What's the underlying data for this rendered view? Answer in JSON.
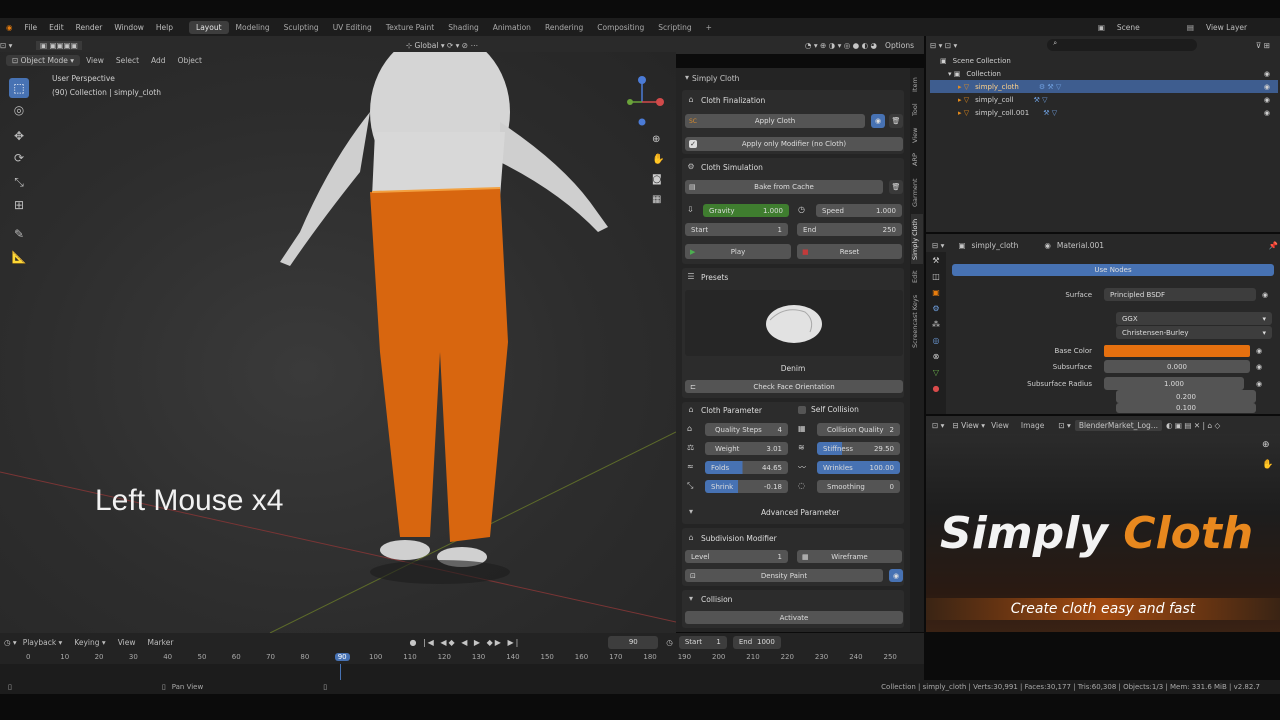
{
  "menu": [
    "File",
    "Edit",
    "Render",
    "Window",
    "Help"
  ],
  "workspaces": [
    "Layout",
    "Modeling",
    "Sculpting",
    "UV Editing",
    "Texture Paint",
    "Shading",
    "Animation",
    "Rendering",
    "Compositing",
    "Scripting"
  ],
  "scene": "Scene",
  "view_layer": "View Layer",
  "viewport": {
    "orientation": "Global",
    "options": "Options",
    "mode": "Object Mode",
    "menus": [
      "View",
      "Select",
      "Add",
      "Object"
    ],
    "overlay_title": "User Perspective",
    "overlay_sub": "(90) Collection | simply_cloth",
    "caption": "Left Mouse x4"
  },
  "n_tabs": [
    "Item",
    "Tool",
    "View",
    "ARP",
    "Garment",
    "Simply Cloth",
    "Edit",
    "Screencast Keys"
  ],
  "simply_cloth": {
    "title": "Simply Cloth",
    "finalization": {
      "title": "Cloth Finalization",
      "sc": "SC",
      "apply": "Apply Cloth",
      "apply_mod": "Apply only Modifier (no Cloth)"
    },
    "simulation": {
      "title": "Cloth Simulation",
      "bake": "Bake from Cache",
      "gravity_label": "Gravity",
      "gravity": "1.000",
      "speed_label": "Speed",
      "speed": "1.000",
      "start_label": "Start",
      "start": "1",
      "end_label": "End",
      "end": "250",
      "play": "Play",
      "reset": "Reset"
    },
    "presets": {
      "title": "Presets",
      "name": "Denim",
      "check": "Check Face Orientation"
    },
    "params": {
      "title": "Cloth Parameter",
      "self_collision": "Self Collision",
      "quality_label": "Quality Steps",
      "quality": "4",
      "collision_label": "Collision Quality",
      "collision": "2",
      "weight_label": "Weight",
      "weight": "3.01",
      "stiffness_label": "Stiffness",
      "stiffness": "29.50",
      "folds_label": "Folds",
      "folds": "44.65",
      "wrinkles_label": "Wrinkles",
      "wrinkles": "100.00",
      "shrink_label": "Shrink",
      "shrink": "-0.18",
      "smoothing_label": "Smoothing",
      "smoothing": "0",
      "advanced": "Advanced Parameter"
    },
    "subdivision": {
      "title": "Subdivision Modifier",
      "level_label": "Level",
      "level": "1",
      "wireframe": "Wireframe",
      "density": "Density Paint"
    },
    "collision": {
      "title": "Collision",
      "activate": "Activate"
    }
  },
  "outliner": {
    "root": "Scene Collection",
    "collection": "Collection",
    "items": [
      "simply_cloth",
      "simply_coll",
      "simply_coll.001"
    ]
  },
  "properties": {
    "object": "simply_cloth",
    "material": "Material.001",
    "use_nodes": "Use Nodes",
    "surface_label": "Surface",
    "surface": "Principled BSDF",
    "dist": "GGX",
    "sss_method": "Christensen-Burley",
    "base_color_label": "Base Color",
    "base_color": "#e5700f",
    "subsurface_label": "Subsurface",
    "subsurface": "0.000",
    "radius_label": "Subsurface Radius",
    "radius": [
      "1.000",
      "0.200",
      "0.100"
    ]
  },
  "image_editor": {
    "view": "View",
    "menus": [
      "View",
      "Image"
    ],
    "image": "BlenderMarket_Log...",
    "logo_a": "Simply",
    "logo_b": "Cloth",
    "tagline": "Create cloth easy and fast"
  },
  "timeline": {
    "menus": [
      "Playback",
      "Keying",
      "View",
      "Marker"
    ],
    "frame": "90",
    "start_label": "Start",
    "start": "1",
    "end_label": "End",
    "end": "1000",
    "ticks": [
      "0",
      "10",
      "20",
      "30",
      "40",
      "50",
      "60",
      "70",
      "80",
      "90",
      "100",
      "110",
      "120",
      "130",
      "140",
      "150",
      "160",
      "170",
      "180",
      "190",
      "200",
      "210",
      "220",
      "230",
      "240",
      "250"
    ]
  },
  "status": {
    "pan": "Pan View",
    "info": "Collection | simply_cloth | Verts:30,991 | Faces:30,177 | Tris:60,308 | Objects:1/3 | Mem: 331.6 MiB | v2.82.7"
  },
  "colors": {
    "accent": "#4772b3",
    "orange": "#e5700f",
    "green": "#3f7d2f"
  }
}
